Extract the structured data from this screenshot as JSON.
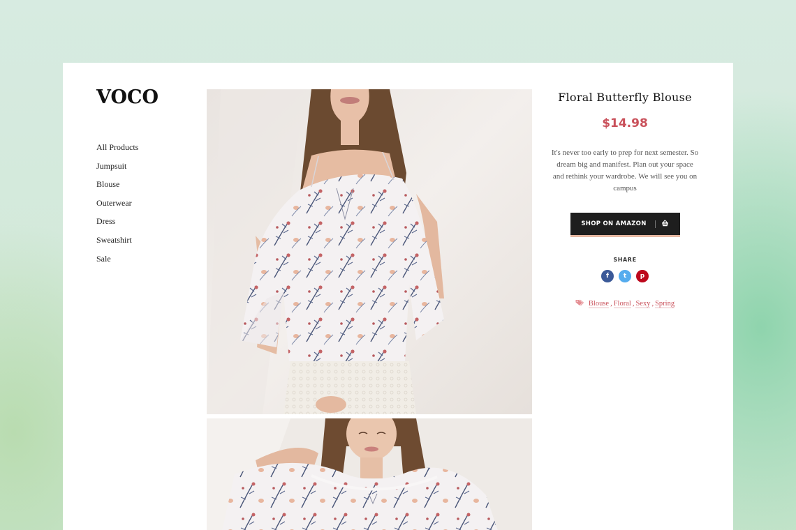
{
  "brand": {
    "logo_text": "VOCO"
  },
  "nav": {
    "items": [
      {
        "label": "All Products"
      },
      {
        "label": "Jumpsuit"
      },
      {
        "label": "Blouse"
      },
      {
        "label": "Outerwear"
      },
      {
        "label": "Dress"
      },
      {
        "label": "Sweatshirt"
      },
      {
        "label": "Sale"
      }
    ]
  },
  "gallery": {
    "images": [
      {
        "icon": "product-photo-floral-blouse-front"
      },
      {
        "icon": "product-photo-floral-blouse-closeup"
      }
    ]
  },
  "product": {
    "title": "Floral Butterfly Blouse",
    "price": "$14.98",
    "description": "It's never too early to prep for next semester. So dream big and manifest. Plan out your space and rethink your wardrobe. We will see you on campus",
    "shop_button_label": "SHOP ON AMAZON",
    "shop_button_icon": "basket-icon",
    "share_label": "SHARE",
    "socials": [
      {
        "name": "facebook",
        "glyph": "f",
        "color": "#3b5998"
      },
      {
        "name": "twitter",
        "glyph": "t",
        "color": "#55acee"
      },
      {
        "name": "pinterest",
        "glyph": "p",
        "color": "#bd081c"
      }
    ],
    "tags": [
      "Blouse",
      "Floral",
      "Sexy",
      "Spring"
    ],
    "tag_separator": ","
  },
  "colors": {
    "accent": "#c9505a",
    "button_bg": "#1e1e1e",
    "button_underline": "#e6b8a3",
    "page_bg": "#d3e9da"
  }
}
